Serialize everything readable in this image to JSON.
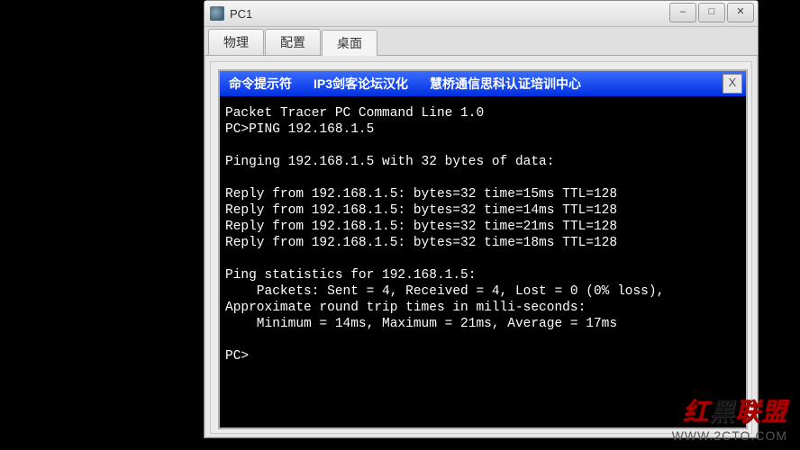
{
  "window": {
    "title": "PC1",
    "controls": {
      "min": "–",
      "max": "□",
      "close": "✕"
    }
  },
  "tabs": {
    "items": [
      {
        "label": "物理"
      },
      {
        "label": "配置"
      },
      {
        "label": "桌面"
      }
    ],
    "active": 2
  },
  "cmd": {
    "title_left": "命令提示符",
    "title_mid": "IP3剑客论坛汉化",
    "title_right": "慧桥通信思科认证培训中心",
    "close": "X"
  },
  "terminal": {
    "lines": [
      "Packet Tracer PC Command Line 1.0",
      "PC>PING 192.168.1.5",
      "",
      "Pinging 192.168.1.5 with 32 bytes of data:",
      "",
      "Reply from 192.168.1.5: bytes=32 time=15ms TTL=128",
      "Reply from 192.168.1.5: bytes=32 time=14ms TTL=128",
      "Reply from 192.168.1.5: bytes=32 time=21ms TTL=128",
      "Reply from 192.168.1.5: bytes=32 time=18ms TTL=128",
      "",
      "Ping statistics for 192.168.1.5:",
      "    Packets: Sent = 4, Received = 4, Lost = 0 (0% loss),",
      "Approximate round trip times in milli-seconds:",
      "    Minimum = 14ms, Maximum = 21ms, Average = 17ms",
      "",
      "PC>"
    ]
  },
  "watermark": {
    "cn_red1": "红",
    "cn_blk": "黑",
    "cn_red2": "联盟",
    "url": "WWW.2CTO.COM"
  }
}
